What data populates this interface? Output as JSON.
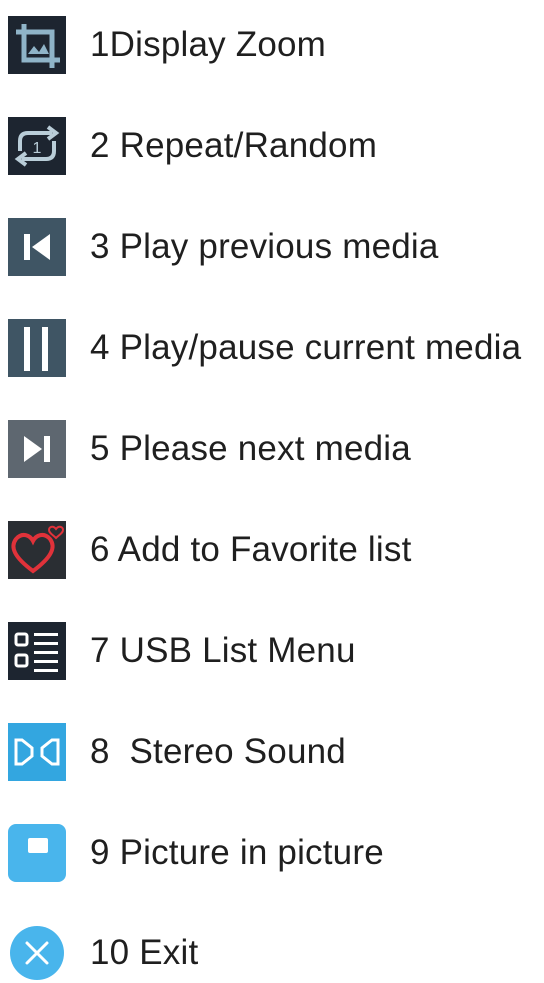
{
  "legend": {
    "items": [
      {
        "icon": "display-zoom-icon",
        "label": "1Display Zoom"
      },
      {
        "icon": "repeat-random-icon",
        "label": "2 Repeat/Random"
      },
      {
        "icon": "previous-icon",
        "label": "3 Play previous media"
      },
      {
        "icon": "pause-icon",
        "label": "4 Play/pause current media"
      },
      {
        "icon": "next-icon",
        "label": "5 Please next media"
      },
      {
        "icon": "favorite-heart-icon",
        "label": "6 Add to Favorite list"
      },
      {
        "icon": "usb-list-menu-icon",
        "label": "7 USB List Menu"
      },
      {
        "icon": "stereo-sound-icon",
        "label": "8  Stereo Sound"
      },
      {
        "icon": "picture-in-picture-icon",
        "label": "9 Picture in picture"
      },
      {
        "icon": "exit-icon",
        "label": "10 Exit"
      }
    ]
  },
  "colors": {
    "text": "#1f1f1f",
    "dark_icon_bg": "#1d2530",
    "slate_icon_bg": "#3f5564",
    "gray_icon_bg": "#5e6770",
    "heart_red": "#e0323a",
    "blue_icon_bg": "#33a6e0",
    "light_blue_icon_bg": "#49b5ec"
  }
}
